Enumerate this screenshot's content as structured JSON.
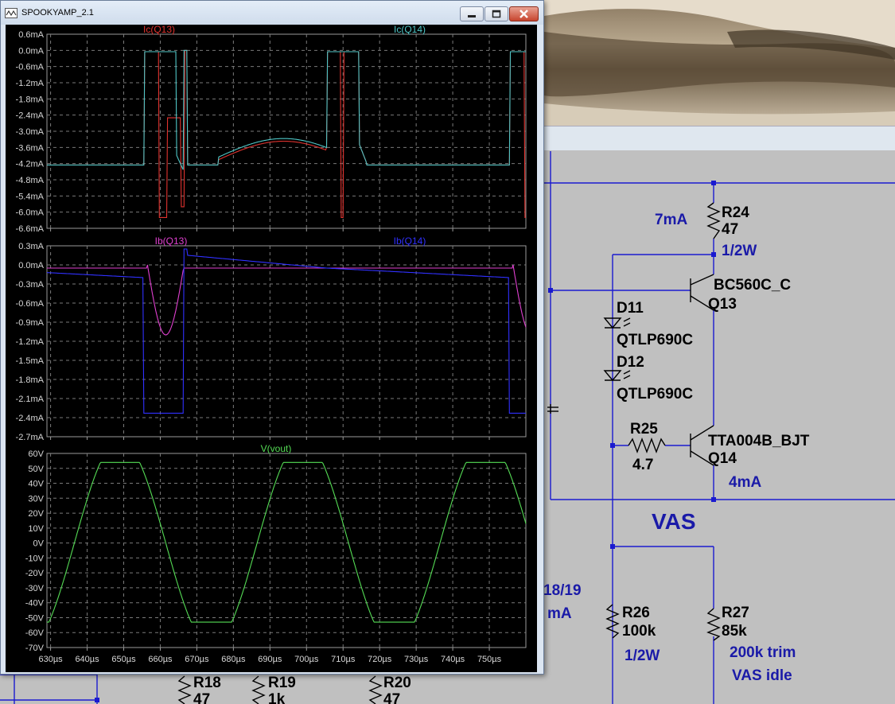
{
  "window": {
    "title": "SPOOKYAMP_2.1"
  },
  "colors": {
    "ic_q13": "#e0332f",
    "ic_q14": "#4fc6c6",
    "ib_q13": "#e040d0",
    "ib_q14": "#3030ff",
    "vout": "#55dd55",
    "schematic_label": "#1a1aa8",
    "wire": "#1a1ad0"
  },
  "schematic": {
    "r24": {
      "name": "R24",
      "value": "47",
      "note": "1/2W",
      "current": "7mA"
    },
    "q13": {
      "model": "BC560C_C",
      "name": "Q13"
    },
    "d11": {
      "name": "D11",
      "model": "QTLP690C"
    },
    "d12": {
      "name": "D12",
      "model": "QTLP690C"
    },
    "r25": {
      "name": "R25",
      "value": "4.7"
    },
    "q14": {
      "model": "TTA004B_BJT",
      "name": "Q14",
      "current": "4mA"
    },
    "stage_label": "VAS",
    "r26": {
      "name": "R26",
      "value": "100k",
      "note": "1/2W"
    },
    "r27": {
      "name": "R27",
      "value": "85k",
      "note1": "200k trim",
      "note2": "VAS idle"
    },
    "partial_label1": "18/19",
    "partial_label2": "mA",
    "r18": {
      "name": "R18",
      "value": "47"
    },
    "r19": {
      "name": "R19",
      "value": "1k"
    },
    "r20": {
      "name": "R20",
      "value": "47"
    }
  },
  "chart_data": [
    {
      "type": "line",
      "series": [
        {
          "name": "Ic(Q13)"
        },
        {
          "name": "Ic(Q14)"
        }
      ],
      "y_ticks": [
        "0.6mA",
        "0.0mA",
        "-0.6mA",
        "-1.2mA",
        "-1.8mA",
        "-2.4mA",
        "-3.0mA",
        "-3.6mA",
        "-4.2mA",
        "-4.8mA",
        "-5.4mA",
        "-6.0mA",
        "-6.6mA"
      ],
      "ylim": [
        -6.6,
        0.6
      ],
      "xlim": [
        629,
        760
      ],
      "unit": "mA"
    },
    {
      "type": "line",
      "series": [
        {
          "name": "Ib(Q13)"
        },
        {
          "name": "Ib(Q14)"
        }
      ],
      "y_ticks": [
        "0.3mA",
        "0.0mA",
        "-0.3mA",
        "-0.6mA",
        "-0.9mA",
        "-1.2mA",
        "-1.5mA",
        "-1.8mA",
        "-2.1mA",
        "-2.4mA",
        "-2.7mA"
      ],
      "ylim": [
        -2.7,
        0.3
      ],
      "xlim": [
        629,
        760
      ],
      "unit": "mA"
    },
    {
      "type": "line",
      "series": [
        {
          "name": "V(vout)"
        }
      ],
      "y_ticks": [
        "60V",
        "50V",
        "40V",
        "30V",
        "20V",
        "10V",
        "0V",
        "-10V",
        "-20V",
        "-30V",
        "-40V",
        "-50V",
        "-60V",
        "-70V"
      ],
      "ylim": [
        -70,
        60
      ],
      "xlim": [
        629,
        760
      ],
      "x_ticks": [
        "630µs",
        "640µs",
        "650µs",
        "660µs",
        "670µs",
        "680µs",
        "690µs",
        "700µs",
        "710µs",
        "720µs",
        "730µs",
        "740µs",
        "750µs"
      ],
      "unit": "V"
    }
  ]
}
